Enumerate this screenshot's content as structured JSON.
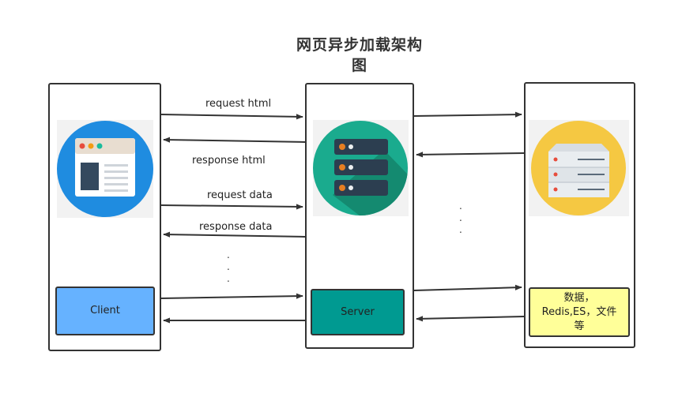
{
  "title_line1": "网页异步加载架构",
  "title_line2": "图",
  "boxes": {
    "client": "Client",
    "server": "Server",
    "storage": "数据，Redis,ES，文件等"
  },
  "arrows": {
    "request_html": "request html",
    "response_html": "response html",
    "request_data": "request data",
    "response_data": "response data"
  },
  "ellipsis": {
    "left": ".\n.\n.",
    "right": ".\n.\n."
  },
  "colors": {
    "client_fill": "#66b2ff",
    "server_fill": "#009a91",
    "storage_fill": "#ffff99",
    "browser_icon_circle": "#1f8ce0",
    "server_icon_circle": "#1aab8e",
    "storage_icon_circle": "#f5c842"
  },
  "icons": {
    "client": "browser-window-icon",
    "server": "server-rack-icon",
    "storage": "database-server-icon"
  }
}
